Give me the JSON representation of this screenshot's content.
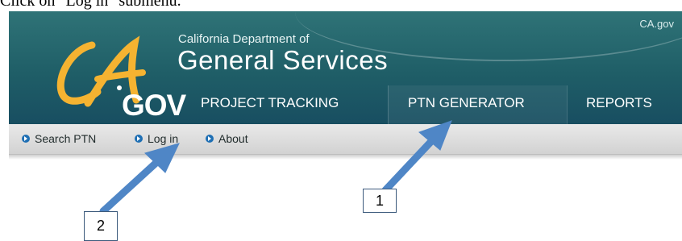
{
  "instruction": "Click on \"Log in\" submenu.",
  "header": {
    "cagov_link": "CA.gov",
    "logo_gov": "GOV",
    "department_line1": "California Department of",
    "department_line2": "General Services"
  },
  "nav": {
    "items": [
      {
        "label": "PROJECT TRACKING"
      },
      {
        "label": "PTN GENERATOR",
        "active": true
      },
      {
        "label": "REPORTS"
      }
    ]
  },
  "submenu": {
    "items": [
      {
        "label": "Search PTN"
      },
      {
        "label": "Log in"
      },
      {
        "label": "About"
      }
    ]
  },
  "annotations": {
    "callout_1": "1",
    "callout_2": "2",
    "arrow_color": "#4f86c6"
  },
  "colors": {
    "banner": "#1f5e67",
    "logo_swoosh": "#f5b331",
    "submenu_bullet": "#1e6fb4"
  }
}
